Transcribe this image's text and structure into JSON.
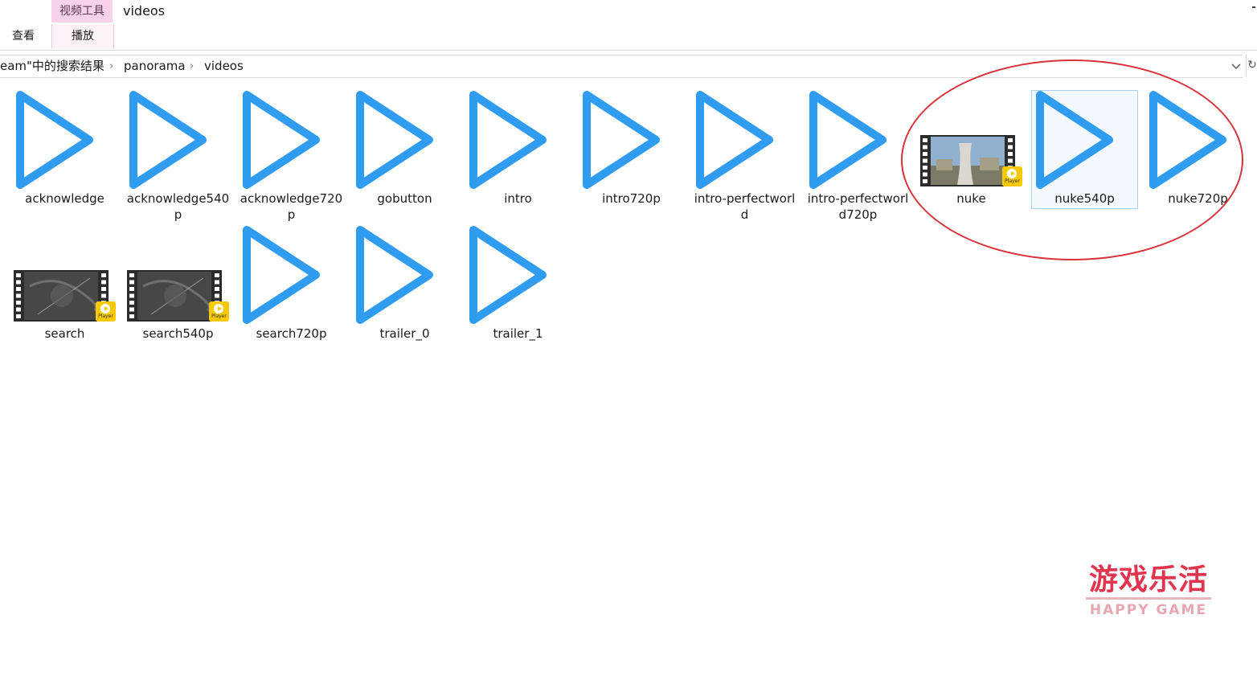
{
  "ribbon": {
    "context_tab": "视频工具",
    "window_title": "videos",
    "tab_view": "查看",
    "tab_play": "播放"
  },
  "address": {
    "crumbs": [
      "eam\"中的搜索结果",
      "panorama",
      "videos"
    ]
  },
  "files": [
    {
      "name": "acknowledge",
      "icon": "play-icon"
    },
    {
      "name": "acknowledge540p",
      "icon": "play-icon"
    },
    {
      "name": "acknowledge720p",
      "icon": "play-icon"
    },
    {
      "name": "gobutton",
      "icon": "play-icon"
    },
    {
      "name": "intro",
      "icon": "play-icon"
    },
    {
      "name": "intro720p",
      "icon": "play-icon"
    },
    {
      "name": "intro-perfectworld",
      "icon": "play-icon"
    },
    {
      "name": "intro-perfectworld720p",
      "icon": "play-icon"
    },
    {
      "name": "nuke",
      "icon": "video-thumbnail"
    },
    {
      "name": "nuke540p",
      "icon": "play-icon",
      "selected": true
    },
    {
      "name": "nuke720p",
      "icon": "play-icon"
    },
    {
      "name": "search",
      "icon": "video-thumbnail"
    },
    {
      "name": "search540p",
      "icon": "video-thumbnail"
    },
    {
      "name": "search720p",
      "icon": "play-icon"
    },
    {
      "name": "trailer_0",
      "icon": "play-icon"
    },
    {
      "name": "trailer_1",
      "icon": "play-icon"
    }
  ],
  "player_badge": "Player",
  "colors": {
    "play_icon": "#2f9cf0",
    "annotation_circle": "#d8323a",
    "context_tab": "#f7d2ea",
    "badge": "#f5c800"
  },
  "watermark": {
    "cn": "游戏乐活",
    "en": "HAPPY GAME"
  }
}
